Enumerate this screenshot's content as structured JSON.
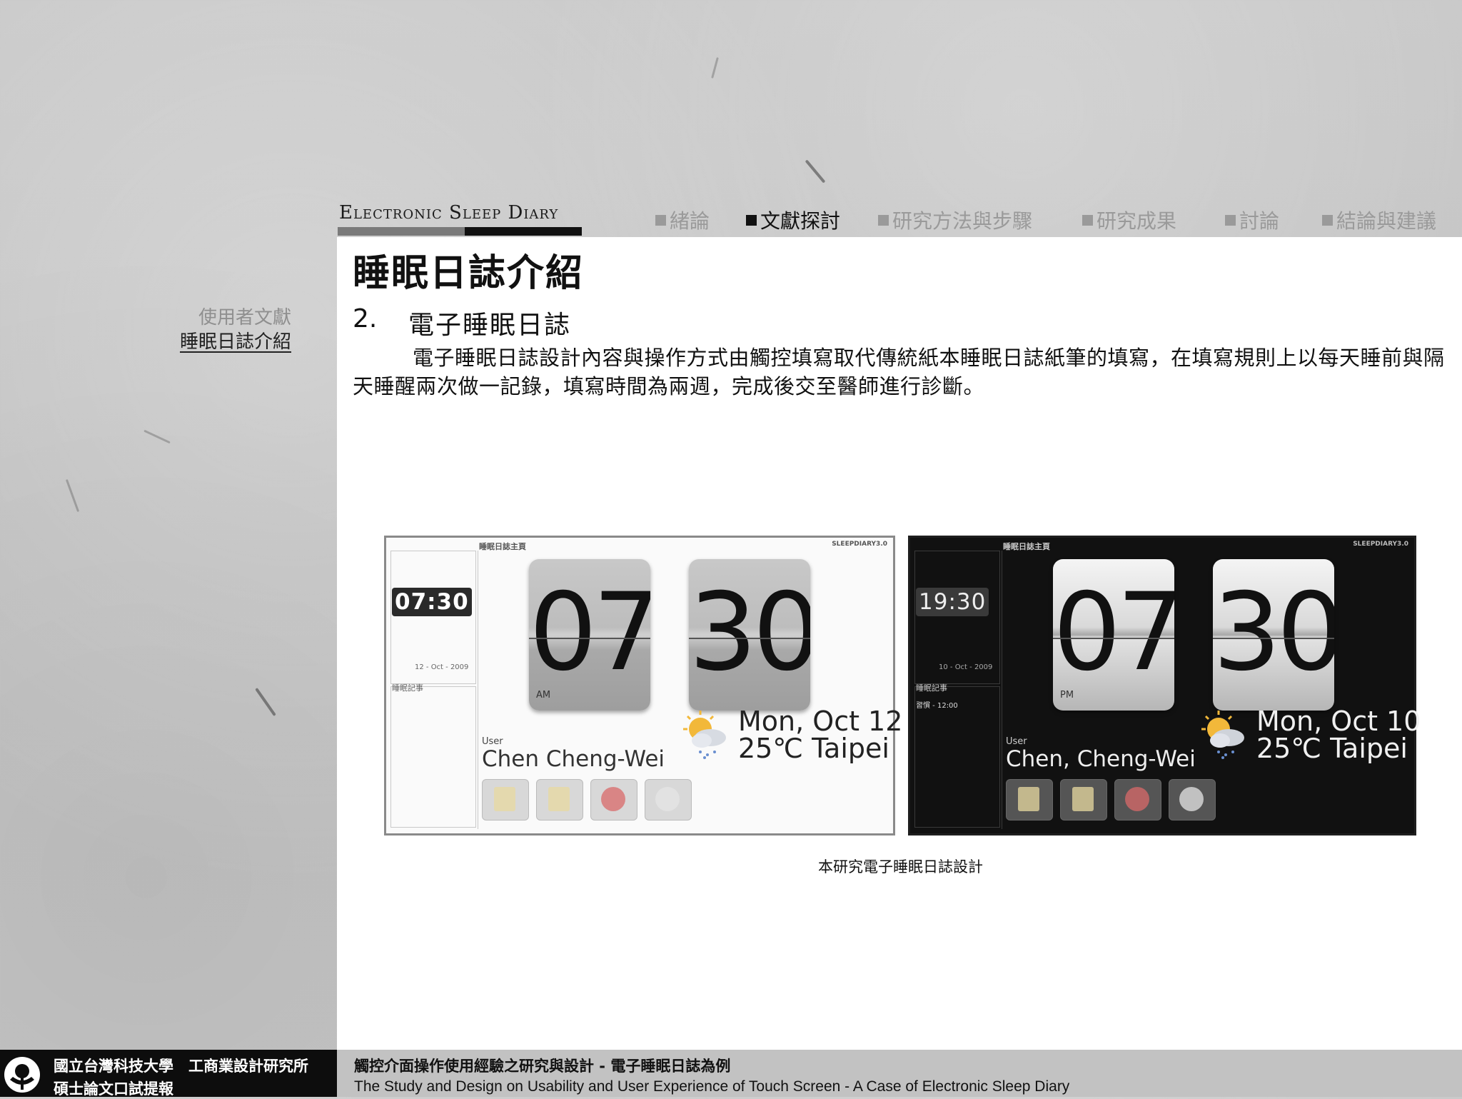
{
  "logo": {
    "text": "Electronic Sleep Diary"
  },
  "nav": [
    {
      "label": "緒論",
      "active": false
    },
    {
      "label": "文獻探討",
      "active": true
    },
    {
      "label": "研究方法與步驟",
      "active": false
    },
    {
      "label": "研究成果",
      "active": false
    },
    {
      "label": "討論",
      "active": false
    },
    {
      "label": "結論與建議",
      "active": false
    }
  ],
  "sidebar": {
    "items": [
      {
        "label": "使用者文獻",
        "active": false
      },
      {
        "label": "睡眠日誌介紹",
        "active": true
      }
    ]
  },
  "content": {
    "title": "睡眠日誌介紹",
    "section_number": "2.",
    "section_title": "電子睡眠日誌",
    "paragraph": "電子睡眠日誌設計內容與操作方式由觸控填寫取代傳統紙本睡眠日誌紙筆的填寫，在填寫規則上以每天睡前與隔天睡醒兩次做一記錄，填寫時間為兩週，完成後交至醫師進行診斷。",
    "caption": "本研究電子睡眠日誌設計"
  },
  "screens": {
    "light": {
      "header": "睡眠日誌主頁",
      "brand": "SLEEPDIARY3.0",
      "small_clock": "07:30",
      "small_date": "12 - Oct - 2009",
      "memo_label": "睡眠記事",
      "hour": "07",
      "minute": "30",
      "ampm": "AM",
      "user_label": "User",
      "user_name": "Chen Cheng-Wei",
      "date": "Mon, Oct 12",
      "temp_city": "25℃  Taipei"
    },
    "dark": {
      "header": "睡眠日誌主頁",
      "brand": "SLEEPDIARY3.0",
      "small_clock": "19:30",
      "small_date": "10 - Oct - 2009",
      "memo_label": "睡眠記事",
      "memo_item": "習慣 - 12:00",
      "hour": "07",
      "minute": "30",
      "ampm": "PM",
      "user_label": "User",
      "user_name": "Chen, Cheng-Wei",
      "date": "Mon, Oct 10",
      "temp_city": "25℃  Taipei"
    }
  },
  "footer": {
    "left_line1": "國立台灣科技大學　工商業設計研究所",
    "left_line2": "碩士論文口試提報",
    "right_line1": "觸控介面操作使用經驗之研究與設計 - 電子睡眠日誌為例",
    "right_line2": "The Study and Design on Usability and User Experience of Touch Screen - A Case of Electronic Sleep Diary"
  },
  "colors": {
    "nav_active": "#111111",
    "nav_inactive": "#9a9a9a",
    "footer_bg": "#0d0d0d"
  }
}
